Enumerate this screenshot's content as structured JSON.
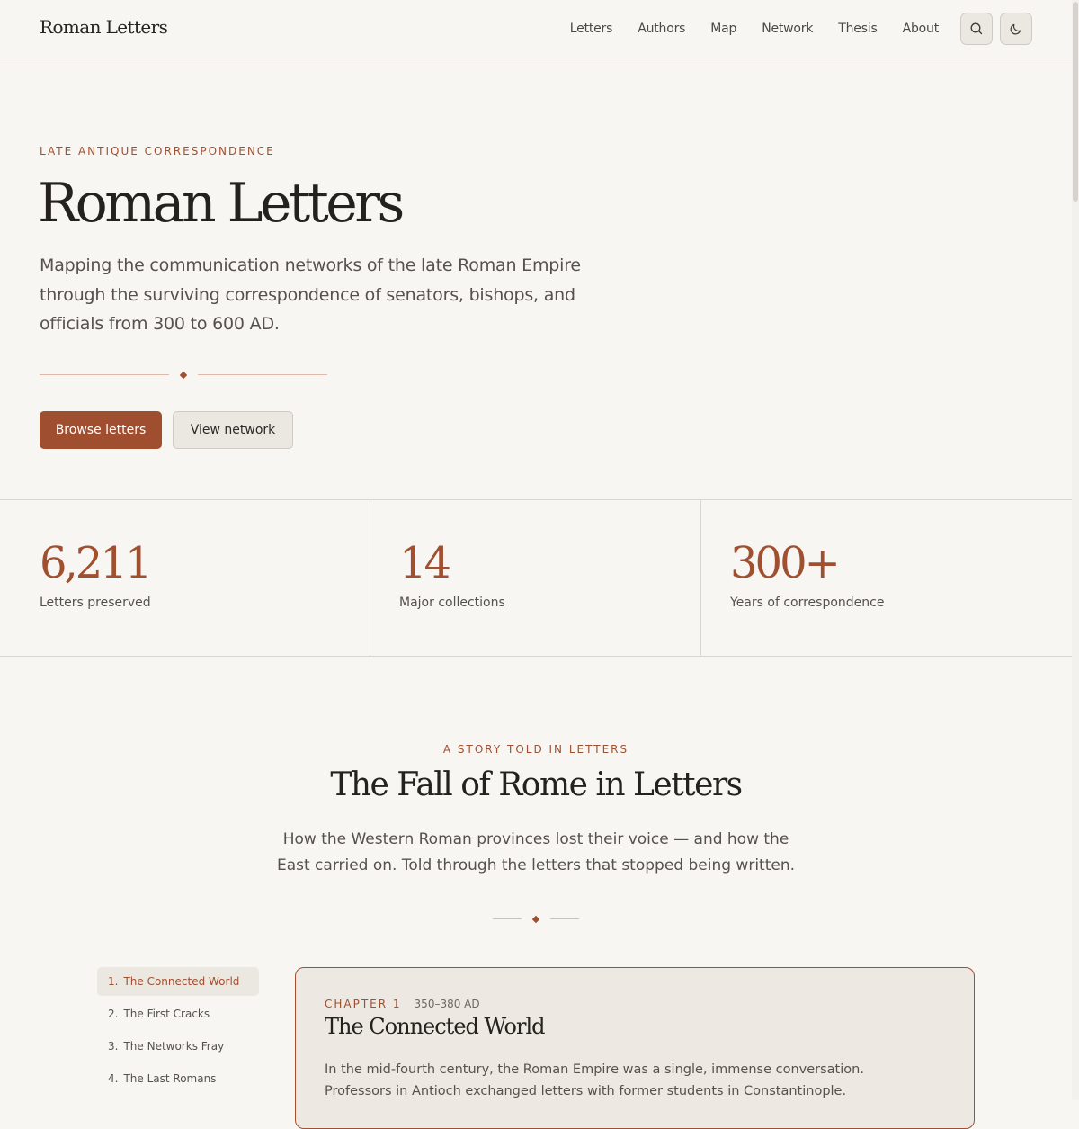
{
  "header": {
    "brand": "Roman Letters",
    "nav": [
      "Letters",
      "Authors",
      "Map",
      "Network",
      "Thesis",
      "About"
    ],
    "search_icon": "search-icon",
    "theme_icon": "moon-icon"
  },
  "hero": {
    "eyebrow": "LATE ANTIQUE CORRESPONDENCE",
    "title": "Roman Letters",
    "description": "Mapping the communication networks of the late Roman Empire through the surviving correspondence of senators, bishops, and officials from 300 to 600 AD.",
    "primary_button": "Browse letters",
    "secondary_button": "View network"
  },
  "stats": [
    {
      "value": "6,211",
      "label": "Letters preserved"
    },
    {
      "value": "14",
      "label": "Major collections"
    },
    {
      "value": "300+",
      "label": "Years of correspondence"
    }
  ],
  "story": {
    "eyebrow": "A STORY TOLD IN LETTERS",
    "title": "The Fall of Rome in Letters",
    "description": "How the Western Roman provinces lost their voice — and how the East carried on. Told through the letters that stopped being written."
  },
  "chapters": [
    {
      "num": "1.",
      "label": "The Connected World"
    },
    {
      "num": "2.",
      "label": "The First Cracks"
    },
    {
      "num": "3.",
      "label": "The Networks Fray"
    },
    {
      "num": "4.",
      "label": "The Last Romans"
    }
  ],
  "chapter_card": {
    "kicker": "CHAPTER 1",
    "years": "350–380 AD",
    "title": "The Connected World",
    "text": "In the mid-fourth century, the Roman Empire was a single, immense conversation. Professors in Antioch exchanged letters with former students in Constantinople."
  },
  "colors": {
    "accent": "#a04e30",
    "background": "#f8f6f3",
    "card_background": "#ede8e2"
  }
}
